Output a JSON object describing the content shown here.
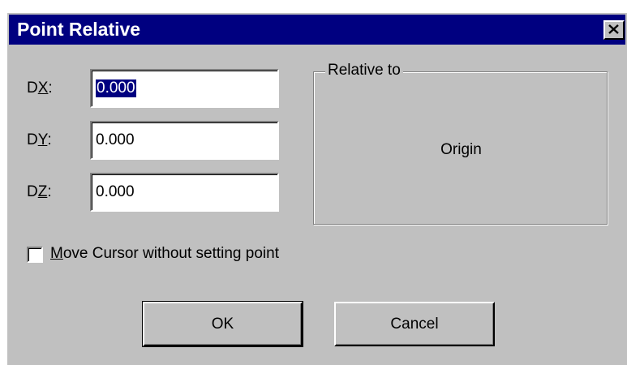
{
  "window": {
    "title": "Point Relative",
    "close_icon": "close-icon"
  },
  "fields": [
    {
      "label_prefix": "D",
      "label_accel": "X",
      "label_suffix": ":",
      "value": "0.000",
      "selected": true
    },
    {
      "label_prefix": "D",
      "label_accel": "Y",
      "label_suffix": ":",
      "value": "0.000",
      "selected": false
    },
    {
      "label_prefix": "D",
      "label_accel": "Z",
      "label_suffix": ":",
      "value": "0.000",
      "selected": false
    }
  ],
  "relative_group": {
    "legend": "Relative to",
    "value": "Origin"
  },
  "move_cursor": {
    "label_accel": "M",
    "label_rest": "ove Cursor without setting point",
    "checked": false
  },
  "buttons": {
    "ok_label": "OK",
    "cancel_label": "Cancel"
  },
  "colors": {
    "title_bar": "#000080",
    "dialog_face": "#c0c0c0",
    "selection": "#000080"
  }
}
